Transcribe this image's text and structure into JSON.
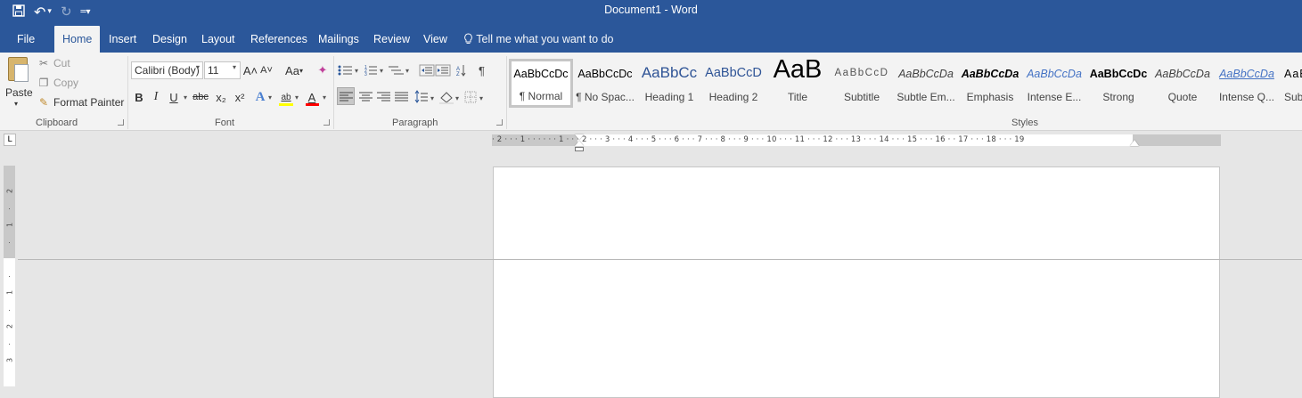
{
  "titlebar": {
    "title": "Document1  -  Word",
    "qat": {
      "save_icon": "💾",
      "undo_icon": "↶",
      "undo_dd": "▾",
      "redo_icon": "↻",
      "customize_icon": "≡"
    }
  },
  "tabs": {
    "file": "File",
    "home": "Home",
    "insert": "Insert",
    "design": "Design",
    "layout": "Layout",
    "references": "References",
    "mailings": "Mailings",
    "review": "Review",
    "view": "View",
    "tell_me": "Tell me what you want to do"
  },
  "clipboard": {
    "paste": "Paste",
    "cut": "Cut",
    "copy": "Copy",
    "format_painter": "Format Painter",
    "label": "Clipboard"
  },
  "font": {
    "name": "Calibri (Body)",
    "size": "11",
    "grow": "A˄",
    "shrink": "A˅",
    "change_case": "Aa",
    "bold": "B",
    "italic": "I",
    "underline": "U",
    "strike": "abc",
    "subscript": "x₂",
    "superscript": "x²",
    "text_effects": "A",
    "highlight": "ab",
    "font_color": "A",
    "label": "Font"
  },
  "paragraph": {
    "pilcrow": "¶",
    "sort": "↕",
    "label": "Paragraph"
  },
  "styles": {
    "label": "Styles",
    "items": [
      {
        "sample": "AaBbCcDc",
        "name": "¶ Normal"
      },
      {
        "sample": "AaBbCcDc",
        "name": "¶ No Spac..."
      },
      {
        "sample": "AaBbCc",
        "name": "Heading 1"
      },
      {
        "sample": "AaBbCcD",
        "name": "Heading 2"
      },
      {
        "sample": "AaB",
        "name": "Title"
      },
      {
        "sample": "AaBbCcD",
        "name": "Subtitle"
      },
      {
        "sample": "AaBbCcDa",
        "name": "Subtle Em..."
      },
      {
        "sample": "AaBbCcDa",
        "name": "Emphasis"
      },
      {
        "sample": "AaBbCcDa",
        "name": "Intense E..."
      },
      {
        "sample": "AaBbCcDc",
        "name": "Strong"
      },
      {
        "sample": "AaBbCcDa",
        "name": "Quote"
      },
      {
        "sample": "AaBbCcDa",
        "name": "Intense Q..."
      },
      {
        "sample": "AaE",
        "name": "Sub"
      }
    ]
  },
  "ruler": {
    "tab_selector": "L",
    "h_numbers": "· 2 · · · 1 · · ·   · · · 1 · · · 2 · · · 3 · · · 4 · · · 5 · · · 6 · · · 7 · · · 8 · · · 9 · · · 10 · · · 11 · · · 12 · · · 13 · · · 14 · · · 15 · · · 16 ·   · 17 · · · 18 · · · 19",
    "v_numbers": [
      "2",
      "1",
      "1",
      "2",
      "3"
    ]
  },
  "colors": {
    "accent": "#2b579a",
    "highlight": "#ffff00",
    "font_color": "#ff0000",
    "heading": "#2f5496"
  }
}
